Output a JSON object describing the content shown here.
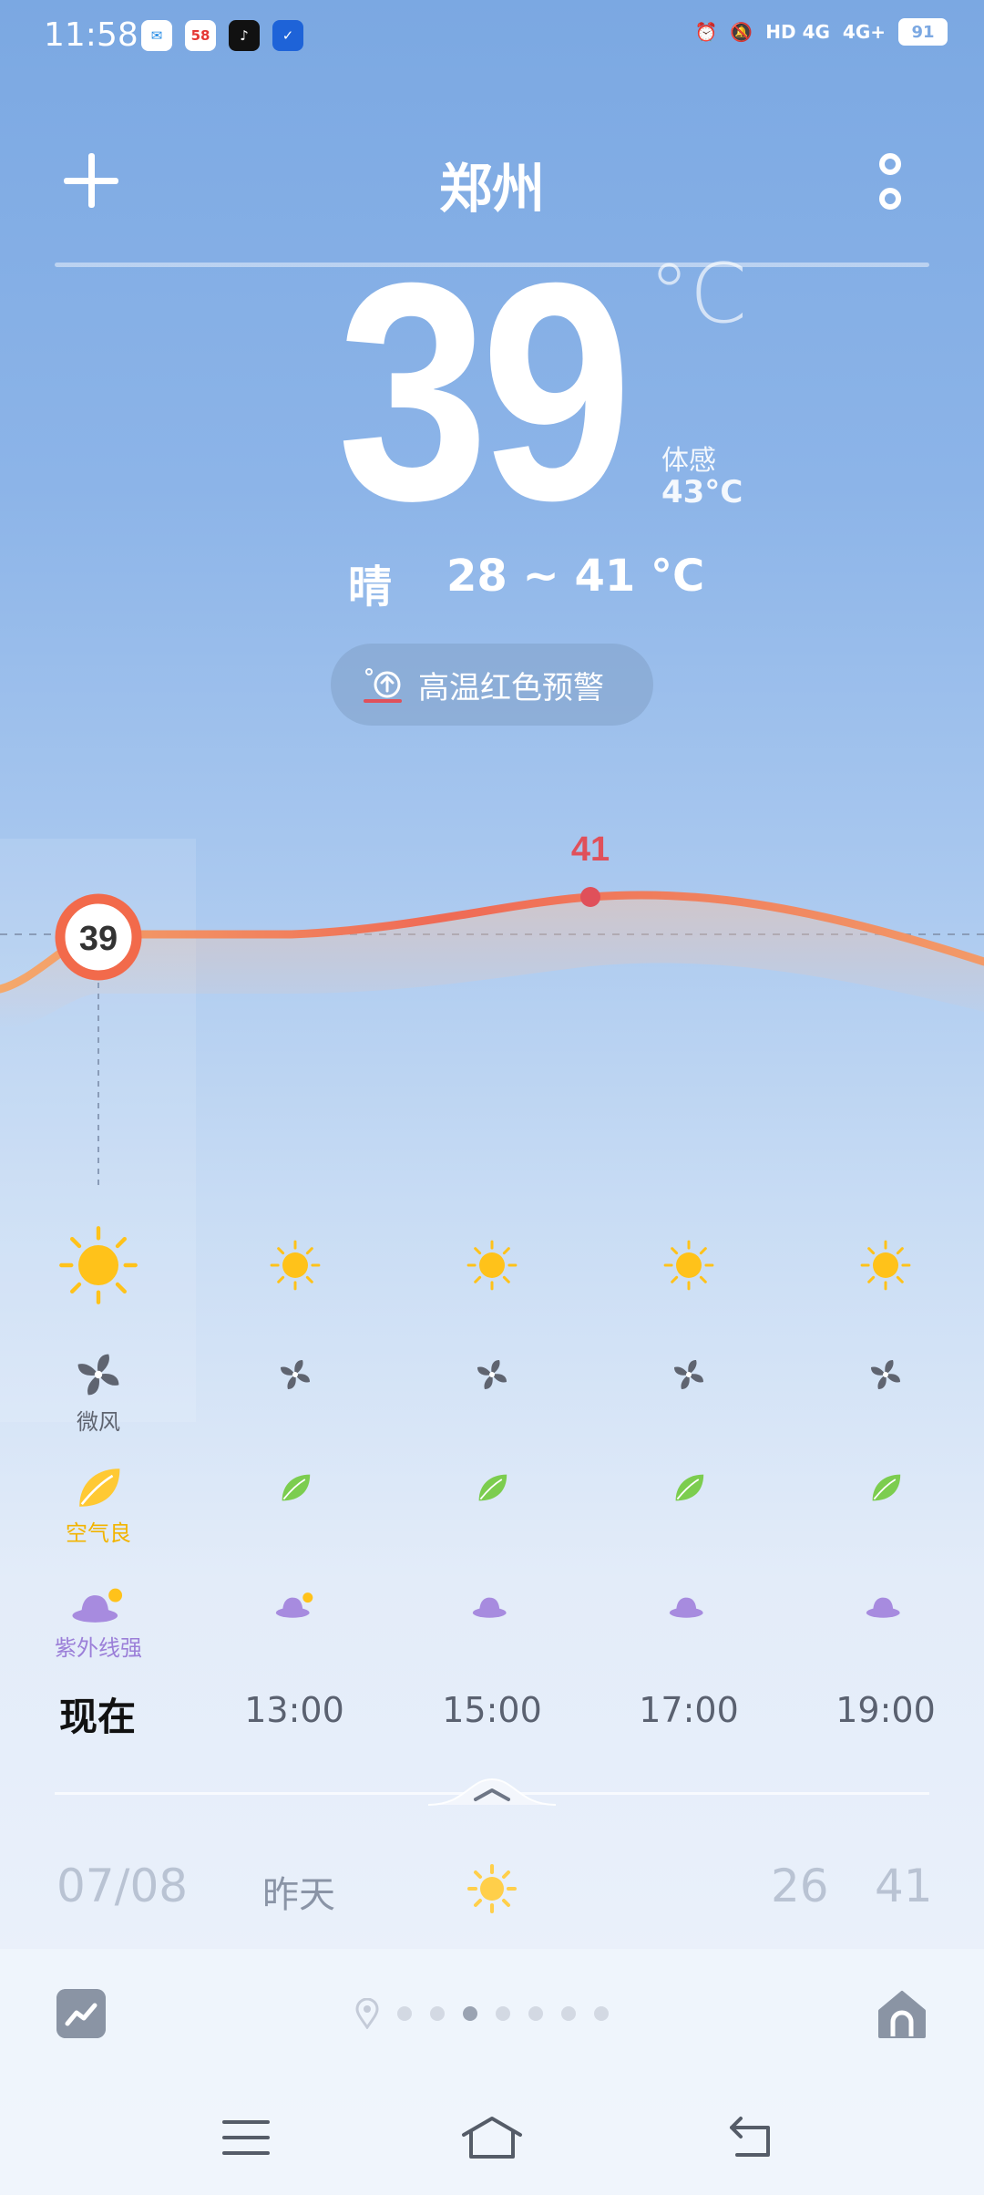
{
  "status": {
    "time": "11:58",
    "apps": [
      {
        "name": "messages",
        "glyph": "✉",
        "color": "#1e88e5"
      },
      {
        "name": "58-app",
        "glyph": "58",
        "color": "#e53935"
      },
      {
        "name": "tiktok",
        "glyph": "♪",
        "color": "#111111"
      },
      {
        "name": "security",
        "glyph": "✓",
        "color": "#1e63d8"
      }
    ],
    "network_1": "HD 4G",
    "network_2": "4G+",
    "battery": "91"
  },
  "header": {
    "city": "郑州"
  },
  "current": {
    "temperature": "39",
    "unit": "°C",
    "feels_label": "体感",
    "feels_value": "43°C",
    "condition": "晴",
    "range": "28 ~ 41 °C"
  },
  "alert": {
    "text": "高温红色预警"
  },
  "chart_data": {
    "type": "line",
    "x": [
      "现在",
      "13:00",
      "15:00",
      "17:00",
      "19:00"
    ],
    "values": [
      39,
      39,
      40,
      41,
      40
    ],
    "labels": [
      {
        "x": "现在",
        "text": "39"
      },
      {
        "x": "15:00–17:00",
        "text": "41"
      }
    ]
  },
  "hourly": {
    "wind_label": "微风",
    "air_label": "空气良",
    "uv_label": "紫外线强",
    "times": [
      "现在",
      "13:00",
      "15:00",
      "17:00",
      "19:00"
    ]
  },
  "daily": {
    "date": "07/08",
    "day": "昨天",
    "low": "26",
    "high": "41"
  },
  "colors": {
    "line_start": "#f2a26a",
    "line_end": "#ec5a50",
    "marker_ring": "#f26a4b",
    "max_label": "#e0505a",
    "sun": "#ffc21a",
    "leaf": "#7ccd4f",
    "air_leaf": "#ffc933",
    "uv_hat": "#a78bdf"
  }
}
